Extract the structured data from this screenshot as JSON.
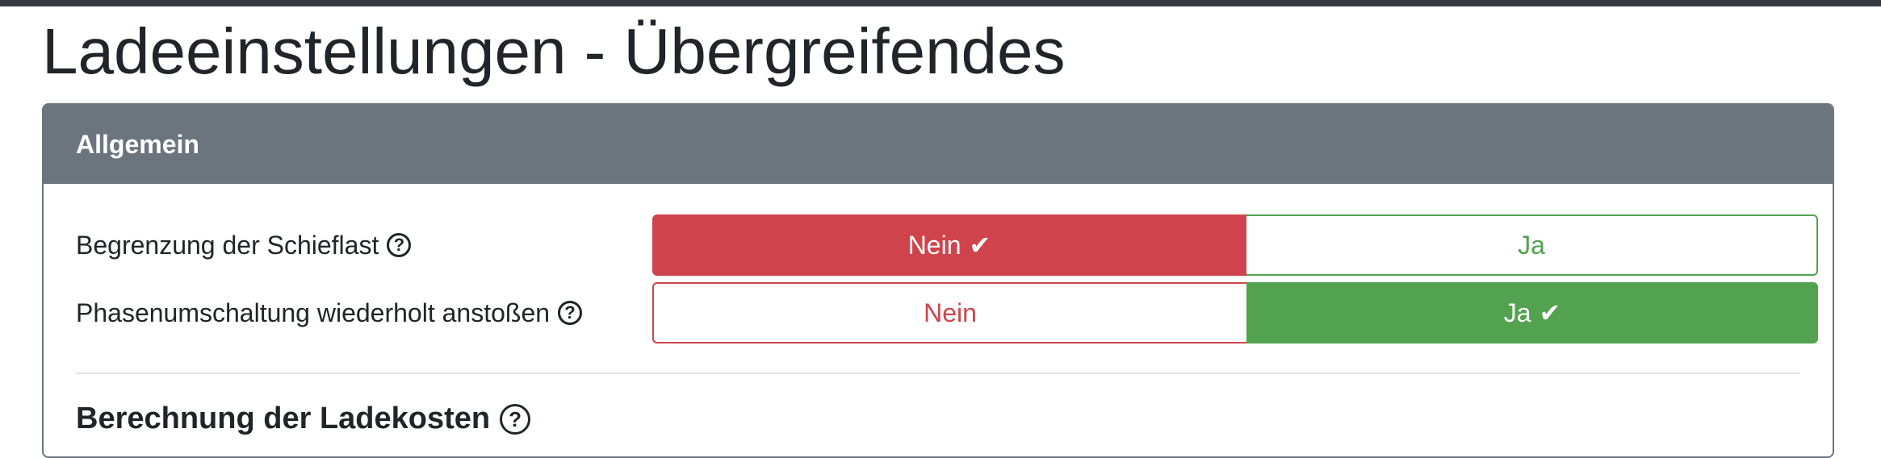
{
  "page": {
    "title": "Ladeeinstellungen - Übergreifendes"
  },
  "card": {
    "header": "Allgemein",
    "rows": [
      {
        "label": "Begrenzung der Schieflast",
        "options": [
          "Nein",
          "Ja"
        ],
        "selected": "Nein"
      },
      {
        "label": "Phasenumschaltung wiederholt anstoßen",
        "options": [
          "Nein",
          "Ja"
        ],
        "selected": "Ja"
      }
    ],
    "section_title": "Berechnung der Ladekosten"
  },
  "icons": {
    "help": "question-circle-icon",
    "check": "check-icon"
  },
  "colors": {
    "danger": "#cf444c",
    "success": "#52a24f",
    "header_bg": "#6c757d"
  }
}
